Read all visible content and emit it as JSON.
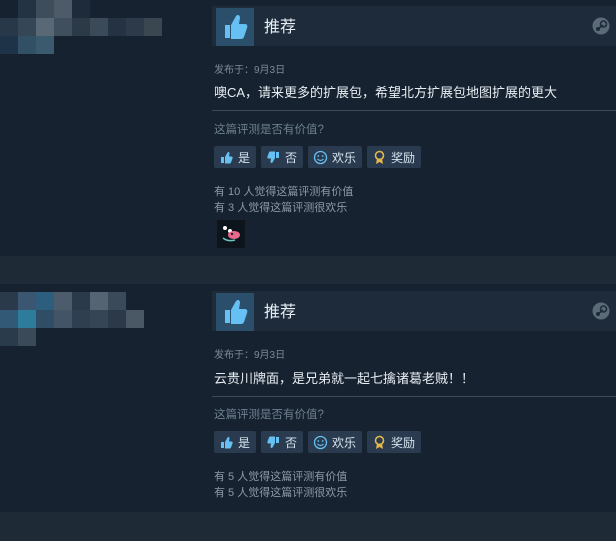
{
  "reviews": [
    {
      "recommendation": "推荐",
      "posted": "发布于：9月3日",
      "content": "噢CA，请来更多的扩展包，希望北方扩展包地图扩展的更大",
      "helpful_question": "这篇评测是否有价值?",
      "buttons": {
        "yes": "是",
        "no": "否",
        "funny": "欢乐",
        "award": "奖励"
      },
      "helpful_count": "有 10 人觉得这篇评测有价值",
      "funny_count": "有 3 人觉得这篇评测很欢乐",
      "award_icon": "award-icon"
    },
    {
      "recommendation": "推荐",
      "posted": "发布于：9月3日",
      "content": "云贵川牌面，是兄弟就一起七擒诸葛老贼！！",
      "helpful_question": "这篇评测是否有价值?",
      "buttons": {
        "yes": "是",
        "no": "否",
        "funny": "欢乐",
        "award": "奖励"
      },
      "helpful_count": "有 5 人觉得这篇评测有价值",
      "funny_count": "有 5 人觉得这篇评测很欢乐"
    }
  ],
  "colors": {
    "background": "#1b2838",
    "thumbs_up": "#66c0f4",
    "award": "#e6b84a"
  },
  "icons": [
    "thumbs-up-icon",
    "thumbs-down-icon",
    "smiley-icon",
    "award-ribbon-icon",
    "steam-logo-icon"
  ]
}
